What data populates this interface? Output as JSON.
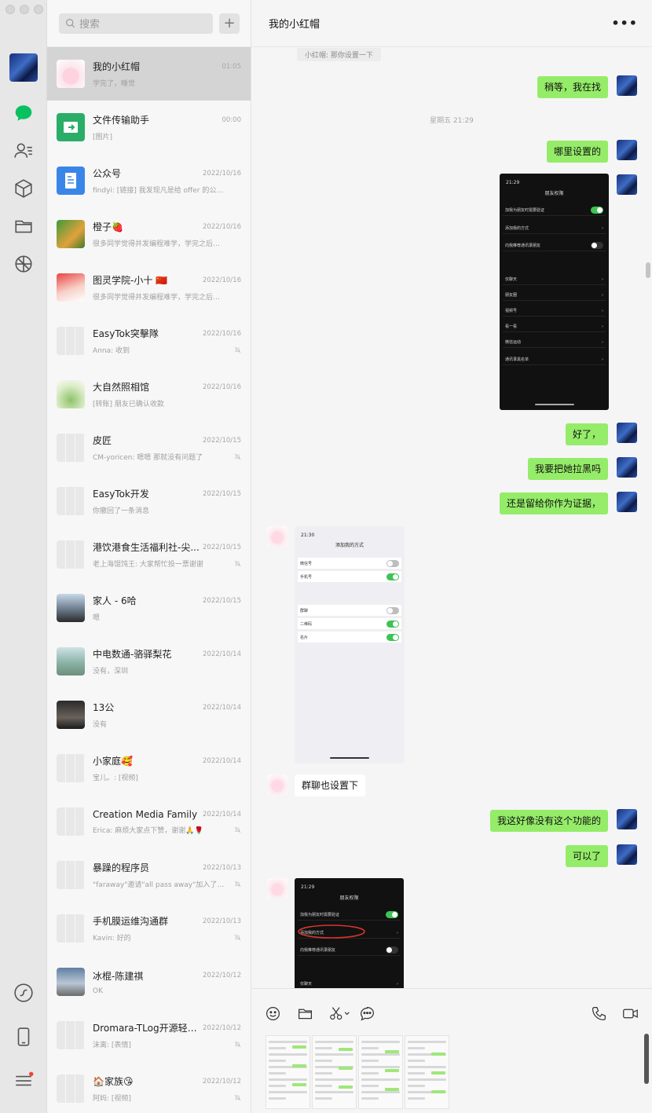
{
  "window": {
    "title": "我的小红帽"
  },
  "search": {
    "placeholder": "搜索"
  },
  "conversations": [
    {
      "name": "我的小红帽",
      "time": "01:05",
      "preview": "学完了，睡觉",
      "muted": false,
      "active": true,
      "avatar": "pink-anime"
    },
    {
      "name": "文件传输助手",
      "time": "00:00",
      "preview": "[图片]",
      "muted": false,
      "avatar": "green-file"
    },
    {
      "name": "公众号",
      "time": "2022/10/16",
      "preview": "findyi: [链接] 我发现凡是给 offer 的公司,...",
      "muted": false,
      "avatar": "blue-doc"
    },
    {
      "name": "橙子🍓",
      "time": "2022/10/16",
      "preview": "很多同学觉得并发编程难学，学完之后工作...",
      "muted": false,
      "avatar": "tiger"
    },
    {
      "name": "图灵学院-小十 🇨🇳",
      "time": "2022/10/16",
      "preview": "很多同学觉得并发编程难学，学完之后工作...",
      "muted": false,
      "avatar": "person-red"
    },
    {
      "name": "EasyTok突擊隊",
      "time": "2022/10/16",
      "preview": "Anna: 收到",
      "muted": true,
      "avatar": "grid"
    },
    {
      "name": "大自然照相馆",
      "time": "2022/10/16",
      "preview": "[转账] 朋友已确认收款",
      "muted": false,
      "avatar": "plant"
    },
    {
      "name": "皮匠",
      "time": "2022/10/15",
      "preview": "CM-yoricen: 嗯嗯 那就没有问题了",
      "muted": true,
      "avatar": "grid"
    },
    {
      "name": "EasyTok开发",
      "time": "2022/10/15",
      "preview": "你撤回了一条消息",
      "muted": false,
      "avatar": "grid"
    },
    {
      "name": "港饮港食生活福利社-尖...",
      "time": "2022/10/15",
      "preview": "老上海馄饨王: 大家帮忙投一票谢谢",
      "muted": true,
      "avatar": "grid"
    },
    {
      "name": "家人 - 6哈",
      "time": "2022/10/15",
      "preview": "嗯",
      "muted": false,
      "avatar": "person-glasses"
    },
    {
      "name": "中电数通-骆驿梨花",
      "time": "2022/10/14",
      "preview": "没有，深圳",
      "muted": false,
      "avatar": "landscape"
    },
    {
      "name": "13公",
      "time": "2022/10/14",
      "preview": "没有",
      "muted": false,
      "avatar": "person-dark"
    },
    {
      "name": "小家庭🥰",
      "time": "2022/10/14",
      "preview": "宝儿。: [视频]",
      "muted": false,
      "avatar": "grid"
    },
    {
      "name": "Creation Media Family",
      "time": "2022/10/14",
      "preview": "Erica: 麻烦大家点下赞，谢谢🙏🌹",
      "muted": true,
      "avatar": "grid"
    },
    {
      "name": "暴躁的程序员",
      "time": "2022/10/13",
      "preview": "\"faraway\"邀请\"all pass away\"加入了群聊",
      "muted": true,
      "avatar": "grid"
    },
    {
      "name": "手机膜运维沟通群",
      "time": "2022/10/13",
      "preview": "Kavin: 好的",
      "muted": true,
      "avatar": "grid"
    },
    {
      "name": "冰棍-陈建祺",
      "time": "2022/10/12",
      "preview": "OK",
      "muted": false,
      "avatar": "sky"
    },
    {
      "name": "Dromara-TLog开源轻量...",
      "time": "2022/10/12",
      "preview": "沫离: [表情]",
      "muted": true,
      "avatar": "grid"
    },
    {
      "name": "🏠家族😘",
      "time": "2022/10/12",
      "preview": "阿妈: [视频]",
      "muted": true,
      "avatar": "grid"
    }
  ],
  "chat": {
    "title": "我的小红帽",
    "more": "•••",
    "quote": "小红帽: 那你设置一下",
    "timestamp": "星期五 21:29",
    "messages": [
      {
        "from": "me",
        "text": "稍等，我在找"
      },
      {
        "from": "me",
        "text": "哪里设置的"
      },
      {
        "from": "me",
        "type": "image"
      },
      {
        "from": "me",
        "text": "好了，"
      },
      {
        "from": "me",
        "text": "我要把她拉黑吗"
      },
      {
        "from": "me",
        "text": "还是留给你作为证据，"
      },
      {
        "from": "her",
        "type": "image"
      },
      {
        "from": "her",
        "text": "群聊也设置下"
      },
      {
        "from": "me",
        "text": "我这好像没有这个功能的"
      },
      {
        "from": "me",
        "text": "可以了"
      },
      {
        "from": "her",
        "type": "image"
      }
    ]
  },
  "screenshot_dark": {
    "time": "21:29",
    "title": "朋友权限",
    "rows": [
      "加我为朋友时需要验证",
      "添加我的方式",
      "向我推荐通讯录朋友",
      "仅聊天",
      "朋友圈",
      "视频号",
      "看一看",
      "微信运动",
      "通讯录黑名单"
    ]
  },
  "screenshot_light": {
    "time": "21:30",
    "title": "添加我的方式",
    "rows": [
      "微信号",
      "手机号",
      "群聊",
      "二维码",
      "名片"
    ]
  },
  "colors": {
    "my_bubble": "#95ec69",
    "her_bubble": "#ffffff",
    "active_row": "#d4d4d4",
    "badge": "#f44336"
  }
}
